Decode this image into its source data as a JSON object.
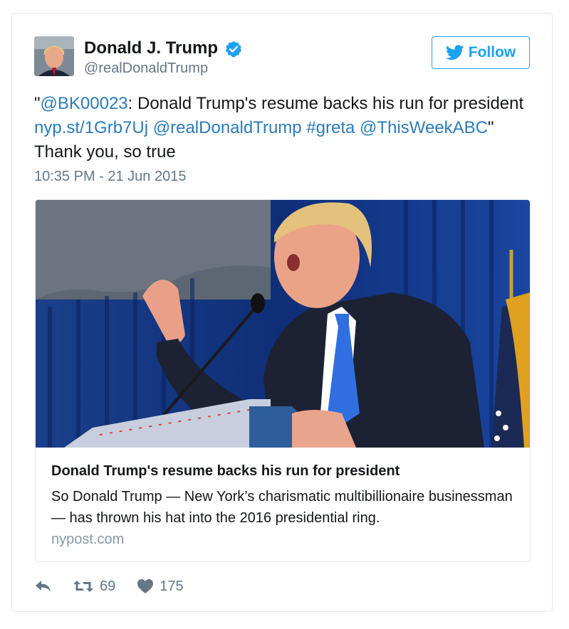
{
  "tweet": {
    "author_name": "Donald J. Trump",
    "author_handle": "@realDonaldTrump",
    "follow_label": "Follow",
    "text": {
      "quote_open": "\"",
      "mention_1": "@BK00023",
      "part_1": ": Donald Trump's resume backs his run for president ",
      "link": "nyp.st/1Grb7Uj",
      "space_1": " ",
      "mention_2": "@realDonaldTrump",
      "space_2": " ",
      "hashtag": "#greta",
      "space_3": " ",
      "mention_3": "@ThisWeekABC",
      "part_2": "\" Thank you, so true"
    },
    "timestamp": "10:35 PM - 21 Jun 2015",
    "card": {
      "title": "Donald Trump's resume backs his run for president",
      "description": "So Donald Trump — New York’s charismatic multibillionaire businessman — has thrown his hat into the 2016 presidential ring.",
      "domain": "nypost.com"
    },
    "actions": {
      "retweets": "69",
      "likes": "175"
    }
  },
  "colors": {
    "link": "#2b7bb9",
    "follow": "#1da1f2",
    "secondary_text": "#657786"
  },
  "icons": [
    "verified-badge-icon",
    "twitter-bird-icon",
    "reply-icon",
    "retweet-icon",
    "heart-icon"
  ]
}
